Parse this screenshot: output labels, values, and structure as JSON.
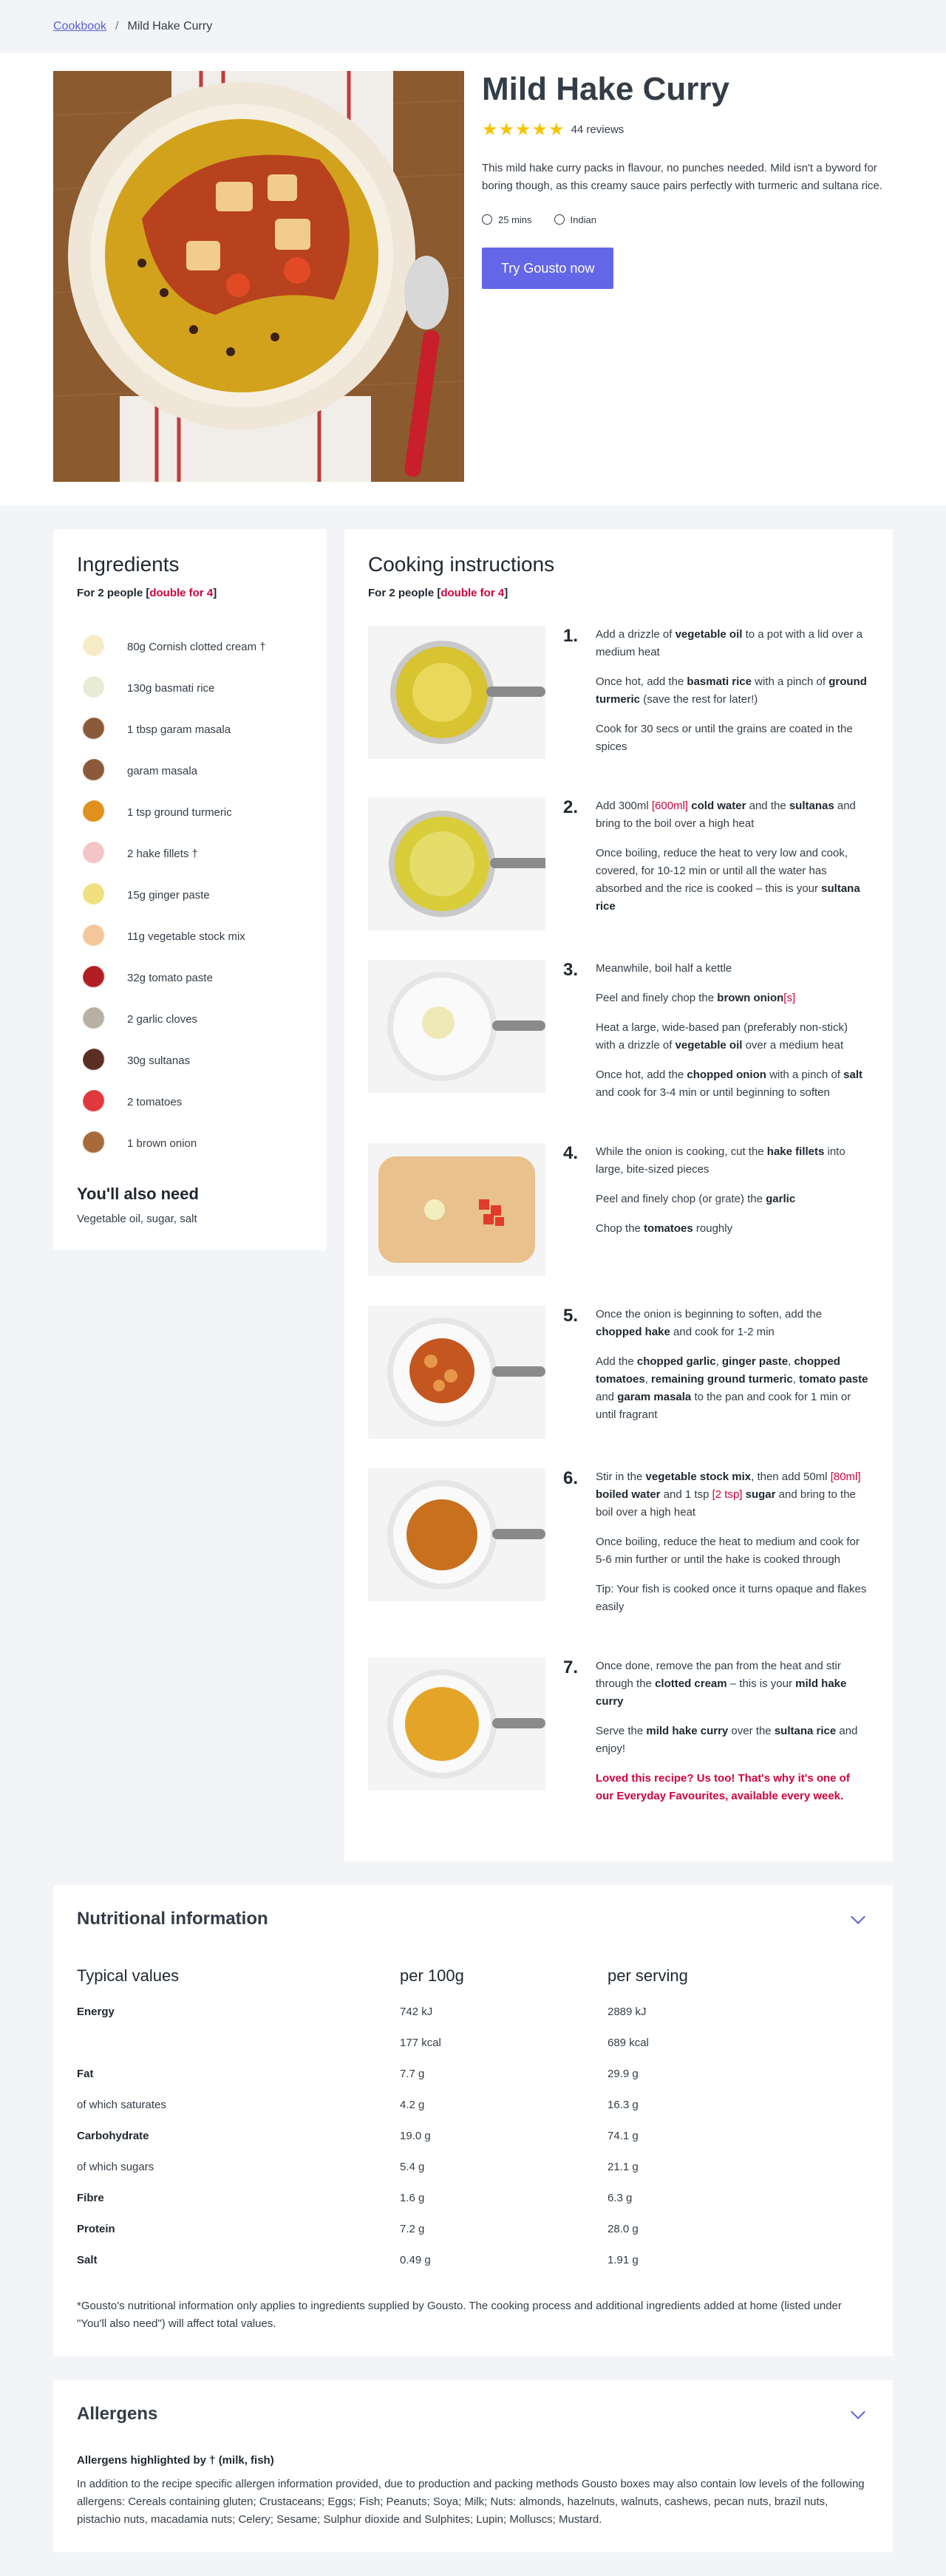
{
  "breadcrumb": {
    "root": "Cookbook",
    "separator": "/",
    "current": "Mild Hake Curry"
  },
  "hero": {
    "title": "Mild Hake Curry",
    "stars": "★★★★★",
    "rating_value": 4.5,
    "reviews": "44 reviews",
    "description": "This mild hake curry packs in flavour, no punches needed. Mild isn't a byword for boring though, as this creamy sauce pairs perfectly with turmeric and sultana rice.",
    "time": "25 mins",
    "cuisine": "Indian",
    "cta": "Try Gousto now"
  },
  "ingredients": {
    "title": "Ingredients",
    "for_prefix": "For 2 people [",
    "for_link": "double for 4",
    "for_suffix": "]",
    "items": [
      {
        "label": "80g Cornish clotted cream †",
        "color": "#f6ecc8"
      },
      {
        "label": "130g basmati rice",
        "color": "#e8ecd4"
      },
      {
        "label": "1 tbsp garam masala",
        "color": "#8a5a3a"
      },
      {
        "label": "garam masala",
        "color": "#8a5a3a"
      },
      {
        "label": "1 tsp ground turmeric",
        "color": "#e0901c"
      },
      {
        "label": "2 hake fillets †",
        "color": "#f2c6c6"
      },
      {
        "label": "15g ginger paste",
        "color": "#f0e080"
      },
      {
        "label": "11g vegetable stock mix",
        "color": "#f3c79a"
      },
      {
        "label": "32g tomato paste",
        "color": "#b21e24"
      },
      {
        "label": "2 garlic cloves",
        "color": "#b8b0a4"
      },
      {
        "label": "30g sultanas",
        "color": "#5a2e22"
      },
      {
        "label": "2 tomatoes",
        "color": "#e0383c"
      },
      {
        "label": "1 brown onion",
        "color": "#a86a38"
      }
    ],
    "also_title": "You'll also need",
    "also_text": "Vegetable oil, sugar, salt"
  },
  "cooking": {
    "title": "Cooking instructions",
    "for_prefix": "For 2 people [",
    "for_link": "double for 4",
    "for_suffix": "]",
    "steps": [
      {
        "num": "1.",
        "img": "pan-oil",
        "html": [
          "Add a drizzle of <b>vegetable oil</b> to a pot with a lid over a medium heat",
          "Once hot, add the <b>basmati rice</b> with a pinch of <b>ground turmeric</b> (save the rest for later!)",
          "Cook for 30 secs or until the grains are coated in the spices"
        ]
      },
      {
        "num": "2.",
        "img": "pan-water",
        "html": [
          "Add 300ml <span class=\"red\">[600ml]</span> <b>cold water</b> and the <b>sultanas</b> and bring to the boil over a high heat",
          "Once boiling, reduce the heat to very low and cook, covered, for 10-12 min or until all the water has absorbed and the rice is cooked – this is your <b>sultana rice</b>"
        ]
      },
      {
        "num": "3.",
        "img": "pan-onion",
        "html": [
          "Meanwhile, boil half a kettle",
          "Peel and finely chop the <b>brown onion</b><span class=\"red\">[s]</span>",
          "Heat a large, wide-based pan (preferably non-stick) with a drizzle of <b>vegetable oil</b> over a medium heat",
          "Once hot, add the <b>chopped onion</b> with a pinch of <b>salt</b> and cook for 3-4 min or until beginning to soften"
        ]
      },
      {
        "num": "4.",
        "img": "board",
        "html": [
          "While the onion is cooking, cut the <b>hake fillets</b> into large, bite-sized pieces",
          "Peel and finely chop (or grate) the <b>garlic</b>",
          "Chop the <b>tomatoes</b> roughly"
        ]
      },
      {
        "num": "5.",
        "img": "pan-fry",
        "html": [
          "Once the onion is beginning to soften, add the <b>chopped hake</b> and cook for 1-2 min",
          "Add the <b>chopped garlic</b>, <b>ginger paste</b>, <b>chopped tomatoes</b>, <b>remaining ground turmeric</b>, <b>tomato paste</b> and <b>garam masala</b> to the pan and cook for 1 min or until fragrant"
        ]
      },
      {
        "num": "6.",
        "img": "pan-stock",
        "html": [
          "Stir in the <b>vegetable stock mix</b>, then add 50ml <span class=\"red\">[80ml]</span> <b>boiled water</b> and 1 tsp <span class=\"red\">[2 tsp]</span> <b>sugar</b> and bring to the boil over a high heat",
          "Once boiling, reduce the heat to medium and cook for 5-6 min further or until the hake is cooked through",
          "Tip: Your fish is cooked once it turns opaque and flakes easily"
        ]
      },
      {
        "num": "7.",
        "img": "pan-cream",
        "html": [
          "Once done, remove the pan from the heat and stir through the <b>clotted cream</b> – this is your <b>mild hake curry</b>",
          "Serve the <b>mild hake curry</b> over the <b>sultana rice</b> and enjoy!",
          "<span class=\"loved\">Loved this recipe? Us too! That's why it's one of our Everyday Favourites, available every week.</span>"
        ]
      }
    ]
  },
  "nutrition": {
    "title": "Nutritional information",
    "headers": [
      "Typical values",
      "per 100g",
      "per serving"
    ],
    "rows": [
      {
        "label": "Energy",
        "bold": true,
        "per100": "742 kJ",
        "serving": "2889 kJ"
      },
      {
        "label": "",
        "bold": false,
        "per100": "177 kcal",
        "serving": "689 kcal"
      },
      {
        "label": "Fat",
        "bold": true,
        "per100": "7.7 g",
        "serving": "29.9 g"
      },
      {
        "label": "of which saturates",
        "bold": false,
        "per100": "4.2 g",
        "serving": "16.3 g"
      },
      {
        "label": "Carbohydrate",
        "bold": true,
        "per100": "19.0 g",
        "serving": "74.1 g"
      },
      {
        "label": "of which sugars",
        "bold": false,
        "per100": "5.4 g",
        "serving": "21.1 g"
      },
      {
        "label": "Fibre",
        "bold": true,
        "per100": "1.6 g",
        "serving": "6.3 g"
      },
      {
        "label": "Protein",
        "bold": true,
        "per100": "7.2 g",
        "serving": "28.0 g"
      },
      {
        "label": "Salt",
        "bold": true,
        "per100": "0.49 g",
        "serving": "1.91 g"
      }
    ],
    "note": "*Gousto's nutritional information only applies to ingredients supplied by Gousto. The cooking process and additional ingredients added at home (listed under \"You'll also need\") will affect total values."
  },
  "allergens": {
    "title": "Allergens",
    "highlight": "Allergens highlighted by † (milk, fish)",
    "text": "In addition to the recipe specific allergen information provided, due to production and packing methods Gousto boxes may also contain low levels of the following allergens: Cereals containing gluten; Crustaceans; Eggs; Fish; Peanuts; Soya; Milk; Nuts: almonds, hazelnuts, walnuts, cashews, pecan nuts, brazil nuts, pistachio nuts, macadamia nuts; Celery; Sesame; Sulphur dioxide and Sulphites; Lupin; Molluscs; Mustard."
  }
}
